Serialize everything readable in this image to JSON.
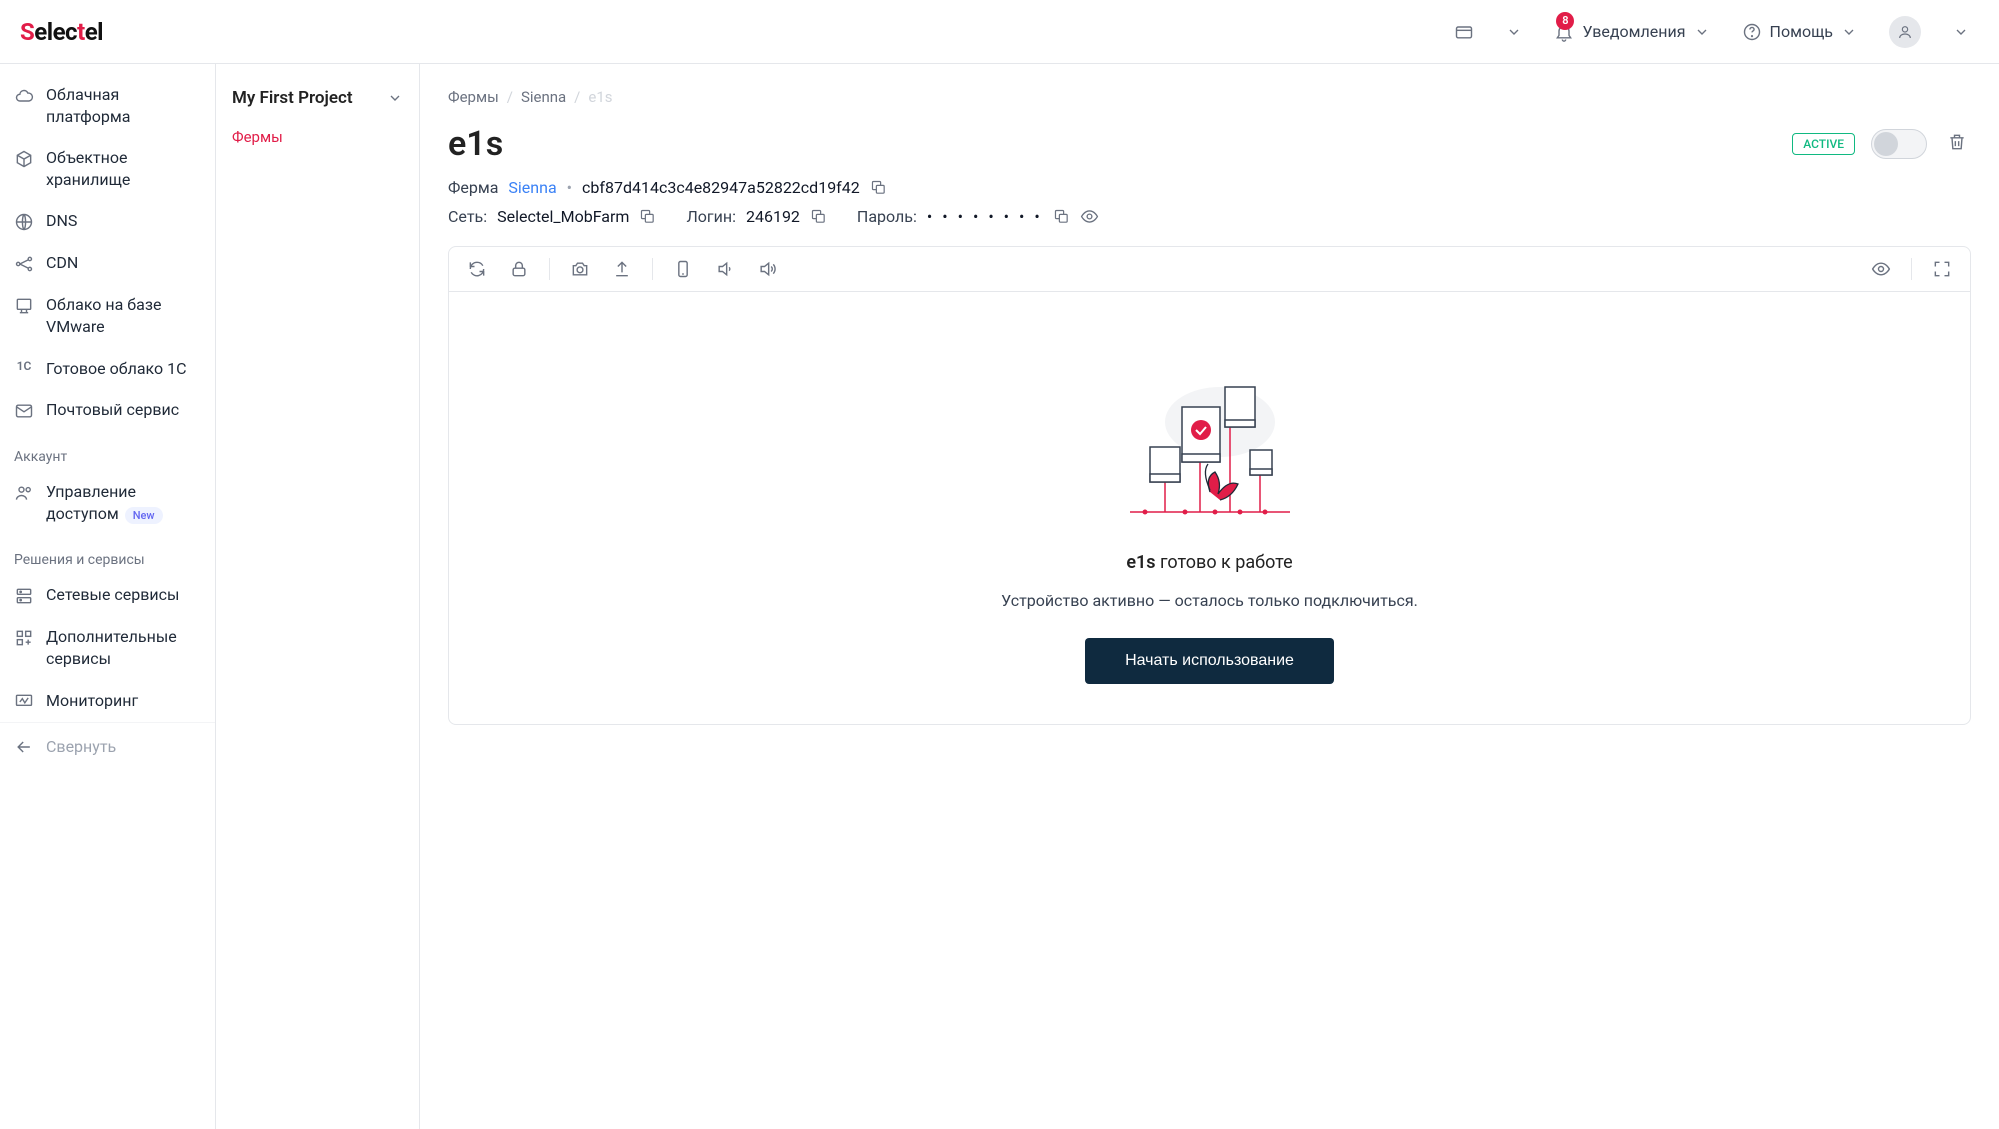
{
  "header": {
    "logo_parts": {
      "s": "S",
      "elec": "elec",
      "t": "t",
      "el": "el"
    },
    "notifications_label": "Уведомления",
    "notifications_count": "8",
    "help_label": "Помощь"
  },
  "sidebar": {
    "items_top": [
      {
        "label": "Облачная платформа",
        "icon": "cloud"
      },
      {
        "label": "Объектное хранилище",
        "icon": "cube"
      },
      {
        "label": "DNS",
        "icon": "globe"
      },
      {
        "label": "CDN",
        "icon": "nodes"
      },
      {
        "label": "Облако на базе VMware",
        "icon": "layers"
      },
      {
        "label": "Готовое облако 1С",
        "icon": "1c"
      },
      {
        "label": "Почтовый сервис",
        "icon": "mail"
      }
    ],
    "section_account": "Аккаунт",
    "items_account": [
      {
        "label": "Управление доступом",
        "icon": "users",
        "badge": "New"
      }
    ],
    "section_solutions": "Решения и сервисы",
    "items_solutions": [
      {
        "label": "Сетевые сервисы",
        "icon": "servers"
      },
      {
        "label": "Дополнительные сервисы",
        "icon": "grid"
      },
      {
        "label": "Мониторинг",
        "icon": "monitor"
      }
    ],
    "collapse": "Свернуть"
  },
  "subsidebar": {
    "project": "My First Project",
    "link": "Фермы"
  },
  "breadcrumb": {
    "farms": "Фермы",
    "sienna": "Sienna",
    "current": "e1s"
  },
  "page": {
    "title": "e1s",
    "status": "ACTIVE",
    "farm_label": "Ферма",
    "farm_link": "Sienna",
    "uuid": "cbf87d414c3c4e82947a52822cd19f42",
    "network_label": "Сеть:",
    "network_value": "Selectel_MobFarm",
    "login_label": "Логин:",
    "login_value": "246192",
    "password_label": "Пароль:",
    "password_value": "• • • • • • • •",
    "ready_device": "e1s",
    "ready_suffix": " готово к работе",
    "ready_sub": "Устройство активно — осталось только подключиться.",
    "start_btn": "Начать использование"
  }
}
